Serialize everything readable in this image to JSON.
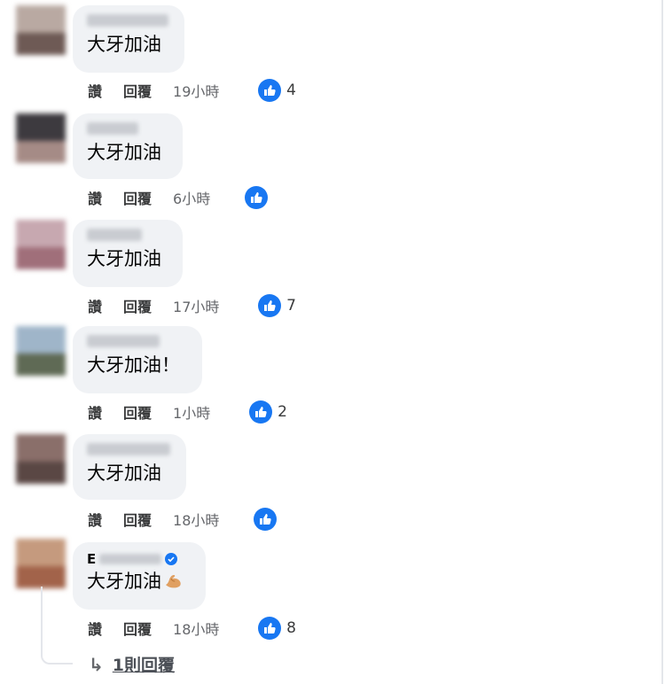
{
  "actions": {
    "like": "讚",
    "reply": "回覆"
  },
  "comments": [
    {
      "text": "大牙加油",
      "time": "19小時",
      "likes": "4"
    },
    {
      "text": "大牙加油",
      "time": "6小時",
      "likes": ""
    },
    {
      "text": "大牙加油",
      "time": "17小時",
      "likes": "7"
    },
    {
      "text": "大牙加油！",
      "time": "1小時",
      "likes": "2"
    },
    {
      "text": "大牙加油",
      "time": "18小時",
      "likes": ""
    },
    {
      "name_initial": "E",
      "text": "大牙加油",
      "time": "18小時",
      "likes": "8"
    }
  ],
  "replies_link": "1則回覆",
  "icons": {
    "like": "thumbs-up-icon",
    "verified": "verified-badge-icon",
    "emoji": "flexed-biceps-icon",
    "reply_arrow": "reply-arrow-icon"
  },
  "colors": {
    "like_blue": "#1877f2",
    "bubble": "#f0f2f5"
  }
}
